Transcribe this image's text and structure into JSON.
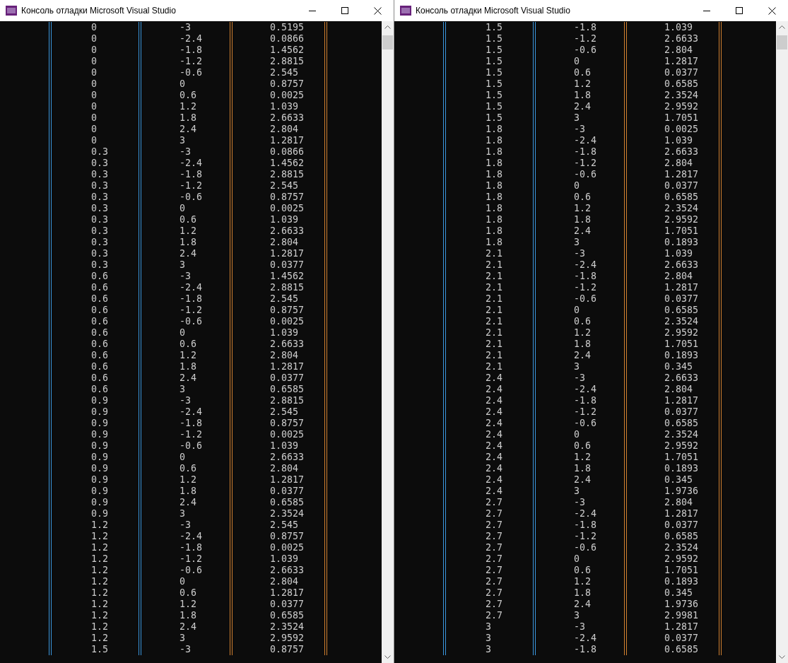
{
  "windows": [
    {
      "title": "Консоль отладки Microsoft Visual Studio",
      "rows": [
        [
          "0",
          "-3",
          "0.5195"
        ],
        [
          "0",
          "-2.4",
          "0.0866"
        ],
        [
          "0",
          "-1.8",
          "1.4562"
        ],
        [
          "0",
          "-1.2",
          "2.8815"
        ],
        [
          "0",
          "-0.6",
          "2.545"
        ],
        [
          "0",
          "0",
          "0.8757"
        ],
        [
          "0",
          "0.6",
          "0.0025"
        ],
        [
          "0",
          "1.2",
          "1.039"
        ],
        [
          "0",
          "1.8",
          "2.6633"
        ],
        [
          "0",
          "2.4",
          "2.804"
        ],
        [
          "0",
          "3",
          "1.2817"
        ],
        [
          "0.3",
          "-3",
          "0.0866"
        ],
        [
          "0.3",
          "-2.4",
          "1.4562"
        ],
        [
          "0.3",
          "-1.8",
          "2.8815"
        ],
        [
          "0.3",
          "-1.2",
          "2.545"
        ],
        [
          "0.3",
          "-0.6",
          "0.8757"
        ],
        [
          "0.3",
          "0",
          "0.0025"
        ],
        [
          "0.3",
          "0.6",
          "1.039"
        ],
        [
          "0.3",
          "1.2",
          "2.6633"
        ],
        [
          "0.3",
          "1.8",
          "2.804"
        ],
        [
          "0.3",
          "2.4",
          "1.2817"
        ],
        [
          "0.3",
          "3",
          "0.0377"
        ],
        [
          "0.6",
          "-3",
          "1.4562"
        ],
        [
          "0.6",
          "-2.4",
          "2.8815"
        ],
        [
          "0.6",
          "-1.8",
          "2.545"
        ],
        [
          "0.6",
          "-1.2",
          "0.8757"
        ],
        [
          "0.6",
          "-0.6",
          "0.0025"
        ],
        [
          "0.6",
          "0",
          "1.039"
        ],
        [
          "0.6",
          "0.6",
          "2.6633"
        ],
        [
          "0.6",
          "1.2",
          "2.804"
        ],
        [
          "0.6",
          "1.8",
          "1.2817"
        ],
        [
          "0.6",
          "2.4",
          "0.0377"
        ],
        [
          "0.6",
          "3",
          "0.6585"
        ],
        [
          "0.9",
          "-3",
          "2.8815"
        ],
        [
          "0.9",
          "-2.4",
          "2.545"
        ],
        [
          "0.9",
          "-1.8",
          "0.8757"
        ],
        [
          "0.9",
          "-1.2",
          "0.0025"
        ],
        [
          "0.9",
          "-0.6",
          "1.039"
        ],
        [
          "0.9",
          "0",
          "2.6633"
        ],
        [
          "0.9",
          "0.6",
          "2.804"
        ],
        [
          "0.9",
          "1.2",
          "1.2817"
        ],
        [
          "0.9",
          "1.8",
          "0.0377"
        ],
        [
          "0.9",
          "2.4",
          "0.6585"
        ],
        [
          "0.9",
          "3",
          "2.3524"
        ],
        [
          "1.2",
          "-3",
          "2.545"
        ],
        [
          "1.2",
          "-2.4",
          "0.8757"
        ],
        [
          "1.2",
          "-1.8",
          "0.0025"
        ],
        [
          "1.2",
          "-1.2",
          "1.039"
        ],
        [
          "1.2",
          "-0.6",
          "2.6633"
        ],
        [
          "1.2",
          "0",
          "2.804"
        ],
        [
          "1.2",
          "0.6",
          "1.2817"
        ],
        [
          "1.2",
          "1.2",
          "0.0377"
        ],
        [
          "1.2",
          "1.8",
          "0.6585"
        ],
        [
          "1.2",
          "2.4",
          "2.3524"
        ],
        [
          "1.2",
          "3",
          "2.9592"
        ],
        [
          "1.5",
          "-3",
          "0.8757"
        ]
      ]
    },
    {
      "title": "Консоль отладки Microsoft Visual Studio",
      "rows": [
        [
          "1.5",
          "-1.8",
          "1.039"
        ],
        [
          "1.5",
          "-1.2",
          "2.6633"
        ],
        [
          "1.5",
          "-0.6",
          "2.804"
        ],
        [
          "1.5",
          "0",
          "1.2817"
        ],
        [
          "1.5",
          "0.6",
          "0.0377"
        ],
        [
          "1.5",
          "1.2",
          "0.6585"
        ],
        [
          "1.5",
          "1.8",
          "2.3524"
        ],
        [
          "1.5",
          "2.4",
          "2.9592"
        ],
        [
          "1.5",
          "3",
          "1.7051"
        ],
        [
          "1.8",
          "-3",
          "0.0025"
        ],
        [
          "1.8",
          "-2.4",
          "1.039"
        ],
        [
          "1.8",
          "-1.8",
          "2.6633"
        ],
        [
          "1.8",
          "-1.2",
          "2.804"
        ],
        [
          "1.8",
          "-0.6",
          "1.2817"
        ],
        [
          "1.8",
          "0",
          "0.0377"
        ],
        [
          "1.8",
          "0.6",
          "0.6585"
        ],
        [
          "1.8",
          "1.2",
          "2.3524"
        ],
        [
          "1.8",
          "1.8",
          "2.9592"
        ],
        [
          "1.8",
          "2.4",
          "1.7051"
        ],
        [
          "1.8",
          "3",
          "0.1893"
        ],
        [
          "2.1",
          "-3",
          "1.039"
        ],
        [
          "2.1",
          "-2.4",
          "2.6633"
        ],
        [
          "2.1",
          "-1.8",
          "2.804"
        ],
        [
          "2.1",
          "-1.2",
          "1.2817"
        ],
        [
          "2.1",
          "-0.6",
          "0.0377"
        ],
        [
          "2.1",
          "0",
          "0.6585"
        ],
        [
          "2.1",
          "0.6",
          "2.3524"
        ],
        [
          "2.1",
          "1.2",
          "2.9592"
        ],
        [
          "2.1",
          "1.8",
          "1.7051"
        ],
        [
          "2.1",
          "2.4",
          "0.1893"
        ],
        [
          "2.1",
          "3",
          "0.345"
        ],
        [
          "2.4",
          "-3",
          "2.6633"
        ],
        [
          "2.4",
          "-2.4",
          "2.804"
        ],
        [
          "2.4",
          "-1.8",
          "1.2817"
        ],
        [
          "2.4",
          "-1.2",
          "0.0377"
        ],
        [
          "2.4",
          "-0.6",
          "0.6585"
        ],
        [
          "2.4",
          "0",
          "2.3524"
        ],
        [
          "2.4",
          "0.6",
          "2.9592"
        ],
        [
          "2.4",
          "1.2",
          "1.7051"
        ],
        [
          "2.4",
          "1.8",
          "0.1893"
        ],
        [
          "2.4",
          "2.4",
          "0.345"
        ],
        [
          "2.4",
          "3",
          "1.9736"
        ],
        [
          "2.7",
          "-3",
          "2.804"
        ],
        [
          "2.7",
          "-2.4",
          "1.2817"
        ],
        [
          "2.7",
          "-1.8",
          "0.0377"
        ],
        [
          "2.7",
          "-1.2",
          "0.6585"
        ],
        [
          "2.7",
          "-0.6",
          "2.3524"
        ],
        [
          "2.7",
          "0",
          "2.9592"
        ],
        [
          "2.7",
          "0.6",
          "1.7051"
        ],
        [
          "2.7",
          "1.2",
          "0.1893"
        ],
        [
          "2.7",
          "1.8",
          "0.345"
        ],
        [
          "2.7",
          "2.4",
          "1.9736"
        ],
        [
          "2.7",
          "3",
          "2.9981"
        ],
        [
          "3",
          "-3",
          "1.2817"
        ],
        [
          "3",
          "-2.4",
          "0.0377"
        ],
        [
          "3",
          "-1.8",
          "0.6585"
        ]
      ]
    }
  ]
}
